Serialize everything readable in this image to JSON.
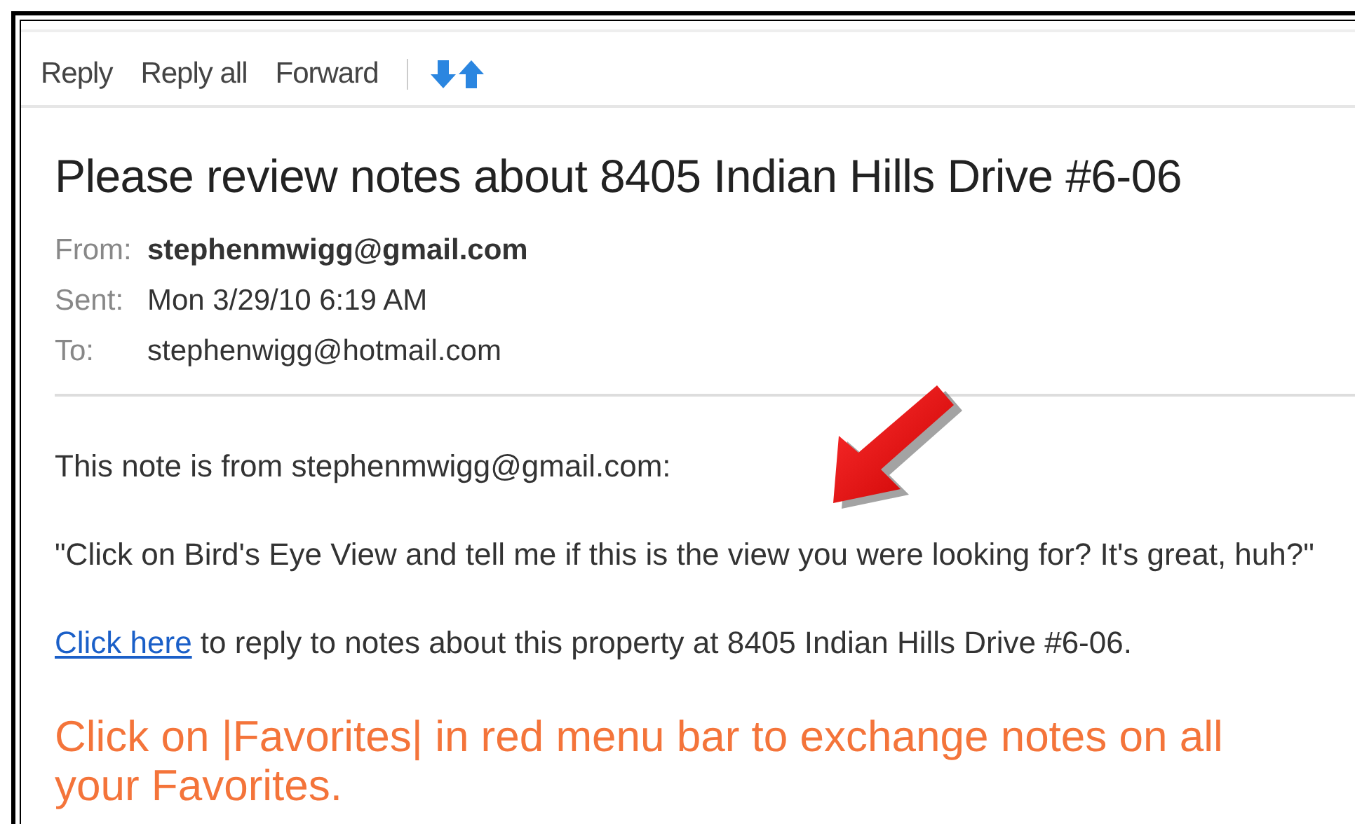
{
  "toolbar": {
    "actions": [
      "Reply",
      "Reply all",
      "Forward"
    ]
  },
  "message": {
    "subject": "Please review notes about 8405 Indian Hills Drive #6-06",
    "headers": [
      {
        "label": "From:",
        "value": "stephenmwigg@gmail.com",
        "bold": true
      },
      {
        "label": "Sent:",
        "value": "Mon 3/29/10 6:19 AM",
        "bold": false
      },
      {
        "label": "To:",
        "value": "stephenwigg@hotmail.com",
        "bold": false
      }
    ],
    "intro": "This note is from stephenmwigg@gmail.com:",
    "quote": "\"Click on Bird's Eye View and tell me if this is the view you were looking for? It's great, huh?\"",
    "link": "Click here",
    "link_rest": " to reply to notes about this property at 8405 Indian Hills Drive #6-06.",
    "callout": "Click on |Favorites| in red menu bar to exchange notes on all your Favorites."
  }
}
